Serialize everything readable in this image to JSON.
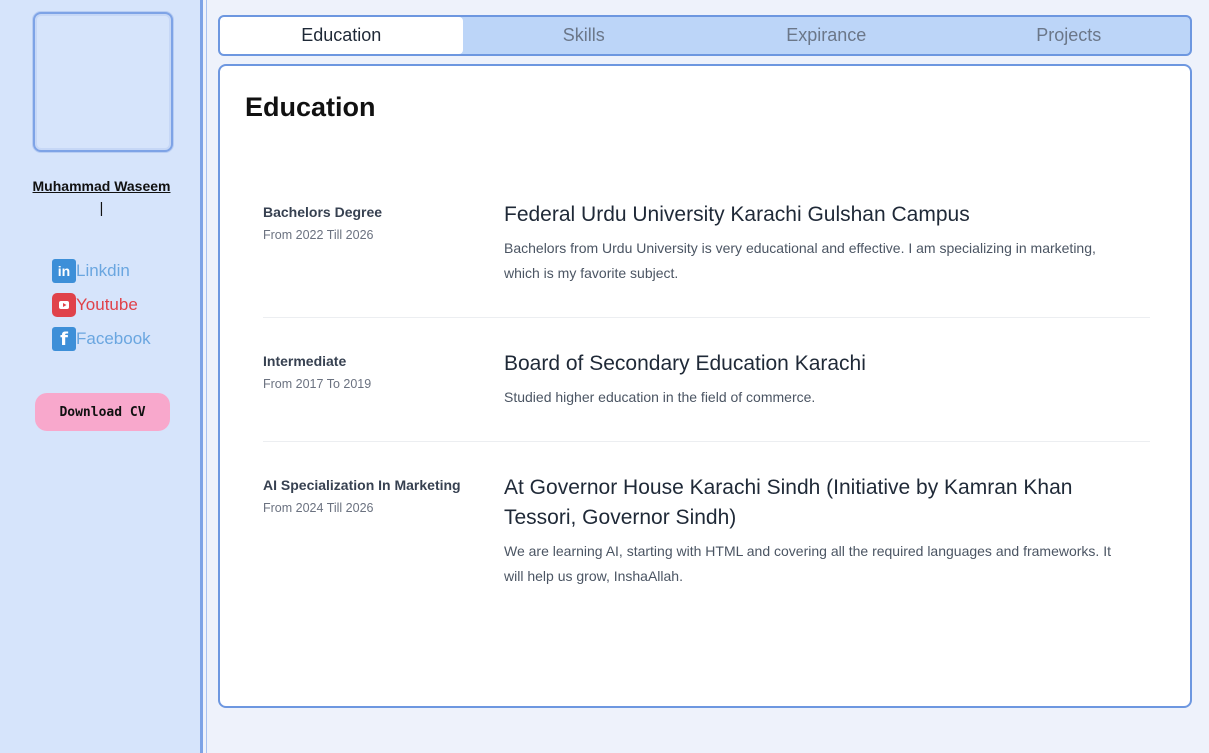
{
  "sidebar": {
    "name": "Muhammad Waseem",
    "cursor": "|",
    "links": [
      {
        "label": "Linkdin",
        "icon": "linkedin-icon",
        "color": "#3d8fd8"
      },
      {
        "label": "Youtube",
        "icon": "youtube-icon",
        "color": "#e0424a"
      },
      {
        "label": "Facebook",
        "icon": "facebook-icon",
        "color": "#3d8fd8"
      }
    ],
    "download_label": "Download CV"
  },
  "tabs": [
    {
      "label": "Education",
      "active": true
    },
    {
      "label": "Skills",
      "active": false
    },
    {
      "label": "Expirance",
      "active": false
    },
    {
      "label": "Projects",
      "active": false
    }
  ],
  "main": {
    "title": "Education",
    "entries": [
      {
        "degree": "Bachelors Degree",
        "dates": "From 2022 Till 2026",
        "institution": "Federal Urdu University Karachi Gulshan Campus",
        "description": "Bachelors from Urdu University is very educational and effective. I am specializing in marketing, which is my favorite subject."
      },
      {
        "degree": "Intermediate",
        "dates": "From 2017 To 2019",
        "institution": "Board of Secondary Education Karachi",
        "description": "Studied higher education in the field of commerce."
      },
      {
        "degree": "AI Specialization In Marketing",
        "dates": "From 2024 Till 2026",
        "institution": "At Governor House Karachi Sindh (Initiative by Kamran Khan Tessori, Governor Sindh)",
        "description": "We are learning AI, starting with HTML and covering all the required languages and frameworks. It will help us grow, InshaAllah."
      }
    ]
  },
  "colors": {
    "sidebar_bg": "#d6e4fb",
    "accent_border": "#6d97e0",
    "tab_bar_bg": "#bcd5f8",
    "download_button": "#f8a8cc"
  }
}
